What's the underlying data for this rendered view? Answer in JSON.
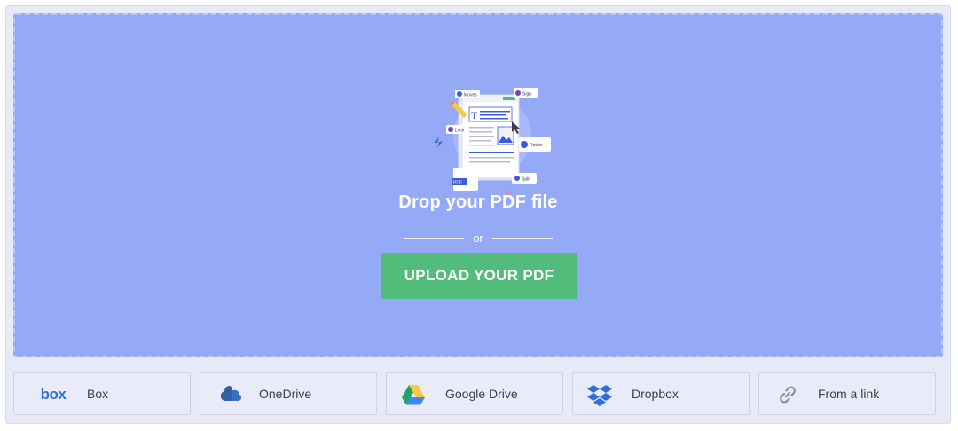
{
  "dropzone": {
    "title": "Drop your PDF file",
    "or_text": "or",
    "upload_label": "UPLOAD YOUR PDF"
  },
  "illustration": {
    "labels": [
      "Moves",
      "Sign",
      "Lock",
      "Rotate",
      "Split",
      "PDF"
    ]
  },
  "sources": [
    {
      "label": "Box",
      "icon": "box-logo-icon",
      "icon_text": "box"
    },
    {
      "label": "OneDrive",
      "icon": "onedrive-icon"
    },
    {
      "label": "Google Drive",
      "icon": "google-drive-icon"
    },
    {
      "label": "Dropbox",
      "icon": "dropbox-icon"
    },
    {
      "label": "From a link",
      "icon": "link-icon"
    }
  ],
  "colors": {
    "dropzone_bg": "#94aaf6",
    "upload_button": "#52bc7a",
    "frame_bg": "#e7eaf6"
  }
}
